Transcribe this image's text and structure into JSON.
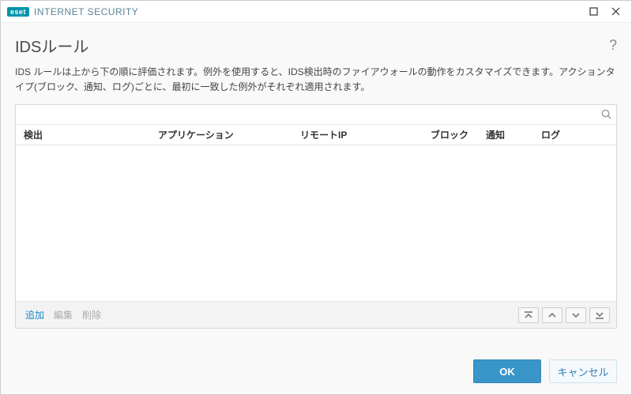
{
  "brand": {
    "badge": "eset",
    "name": "INTERNET SECURITY"
  },
  "page": {
    "title": "IDSルール",
    "description": "IDS ルールは上から下の順に評価されます。例外を使用すると、IDS検出時のファイアウォールの動作をカスタマイズできます。アクションタイプ(ブロック、通知、ログ)ごとに、最初に一致した例外がそれぞれ適用されます。"
  },
  "search": {
    "value": ""
  },
  "columns": {
    "detection": "検出",
    "application": "アプリケーション",
    "remote_ip": "リモートIP",
    "block": "ブロック",
    "notify": "通知",
    "log": "ログ"
  },
  "rows": [],
  "toolbar": {
    "add": "追加",
    "edit": "編集",
    "delete": "削除"
  },
  "footer": {
    "ok": "OK",
    "cancel": "キャンセル"
  }
}
